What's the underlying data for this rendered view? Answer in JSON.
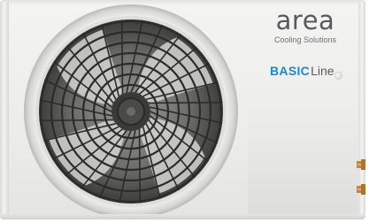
{
  "product": {
    "brand_name": "area",
    "brand_tagline": "Cooling Solutions",
    "series_main": "BASIC",
    "series_sub": "Line"
  },
  "colors": {
    "body": "#ececea",
    "brand_text": "#58595b",
    "series_accent": "#1e88c9",
    "fan_grille": "#3a3a3a",
    "valve_brass": "#c08a3e"
  },
  "icons": {
    "fan": "fan-grille-icon",
    "indicator": "indicator-light-icon",
    "valve": "service-valve-icon"
  }
}
